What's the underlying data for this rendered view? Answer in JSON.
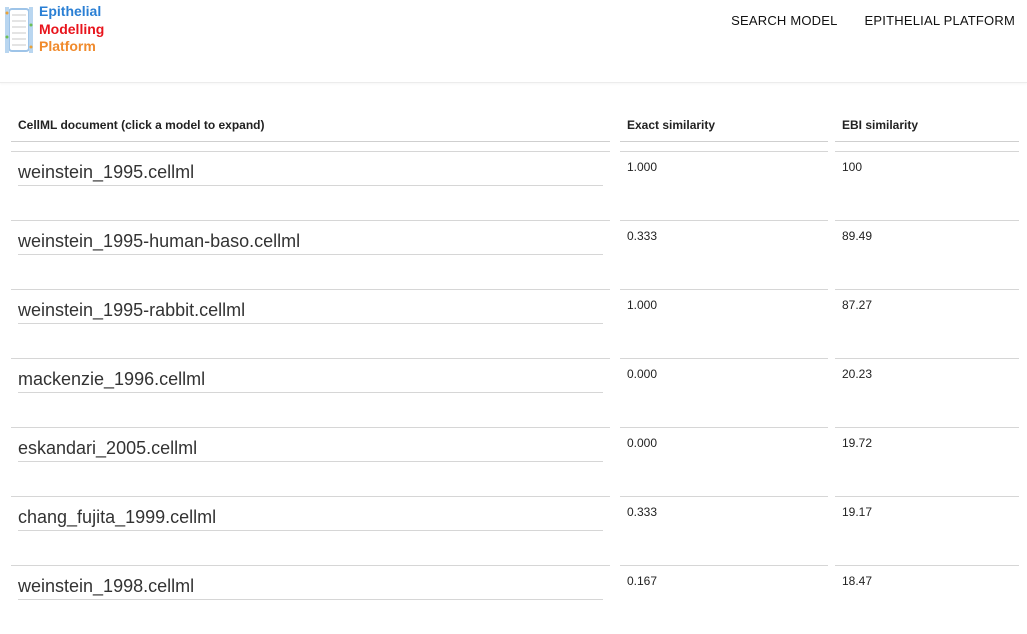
{
  "logo": {
    "line1": "Epithelial",
    "line2": "Modelling",
    "line3": "Platform",
    "colors": {
      "line1": "#2a7fd4",
      "line2": "#e8141c",
      "line3": "#f08a2c"
    }
  },
  "nav": {
    "search_model": "SEARCH MODEL",
    "epithelial_platform": "EPITHELIAL PLATFORM"
  },
  "table": {
    "headers": {
      "document": "CellML document (click a model to expand)",
      "exact": "Exact similarity",
      "ebi": "EBI similarity"
    },
    "rows": [
      {
        "document": "weinstein_1995.cellml",
        "exact": "1.000",
        "ebi": "100"
      },
      {
        "document": "weinstein_1995-human-baso.cellml",
        "exact": "0.333",
        "ebi": "89.49"
      },
      {
        "document": "weinstein_1995-rabbit.cellml",
        "exact": "1.000",
        "ebi": "87.27"
      },
      {
        "document": "mackenzie_1996.cellml",
        "exact": "0.000",
        "ebi": "20.23"
      },
      {
        "document": "eskandari_2005.cellml",
        "exact": "0.000",
        "ebi": "19.72"
      },
      {
        "document": "chang_fujita_1999.cellml",
        "exact": "0.333",
        "ebi": "19.17"
      },
      {
        "document": "weinstein_1998.cellml",
        "exact": "0.167",
        "ebi": "18.47"
      }
    ]
  }
}
